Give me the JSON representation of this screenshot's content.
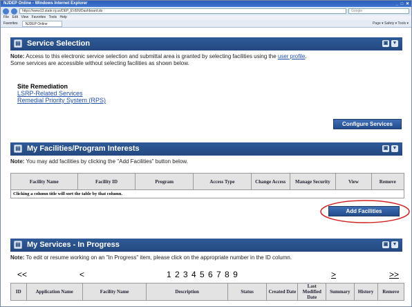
{
  "browser": {
    "title": "NJDEP Online - Windows Internet Explorer",
    "url": "https://www13.state.nj.us/DEP_EVEN/Dashboard.do",
    "search_placeholder": "Google",
    "menu": "File  Edit  View  Favorites  Tools  Help",
    "favorites": "Favorites",
    "tab": "NJDEP Online",
    "tools": "Page ▾  Safety ▾  Tools ▾"
  },
  "service_selection": {
    "title": "Service Selection",
    "note_prefix": "Note:",
    "note_text": "Access to this electronic service selection and submittal area is granted by selecting facilities using the",
    "note_link": "user profile",
    "note_text2": "Some services are accessible without selecting facilities as shown below.",
    "group_title": "Site Remediation",
    "links": [
      "LSRP-Related Services",
      "Remedial Priority System (RPS)"
    ],
    "configure_button": "Configure Services"
  },
  "facilities": {
    "title": "My Facilities/Program Interests",
    "note_prefix": "Note:",
    "note_text": "You may add facilities by clicking the \"Add Facilities\" button below.",
    "columns": [
      "Facility Name",
      "Facility ID",
      "Program",
      "Access Type",
      "Change Access",
      "Manage Security",
      "View",
      "Remove"
    ],
    "sort_hint": "Clicking a column title will sort the table by that column.",
    "add_button": "Add Facilities"
  },
  "services": {
    "title": "My Services - In Progress",
    "note_prefix": "Note:",
    "note_text": "To edit or resume working on an \"In Progress\" item, please click on the appropriate number in the ID column.",
    "pager": {
      "first": "<<",
      "prev": "<",
      "pages": "1 2 3 4 5 6 7 8 9",
      "next": ">",
      "last": ">>"
    },
    "columns": [
      "ID",
      "Application Name",
      "Facility Name",
      "Description",
      "Status",
      "Created Date",
      "Last Modified Date",
      "Summary",
      "History",
      "Remove"
    ]
  },
  "colors": {
    "header": "#24497f",
    "highlight": "#d22222",
    "link": "#1f4fa8"
  }
}
